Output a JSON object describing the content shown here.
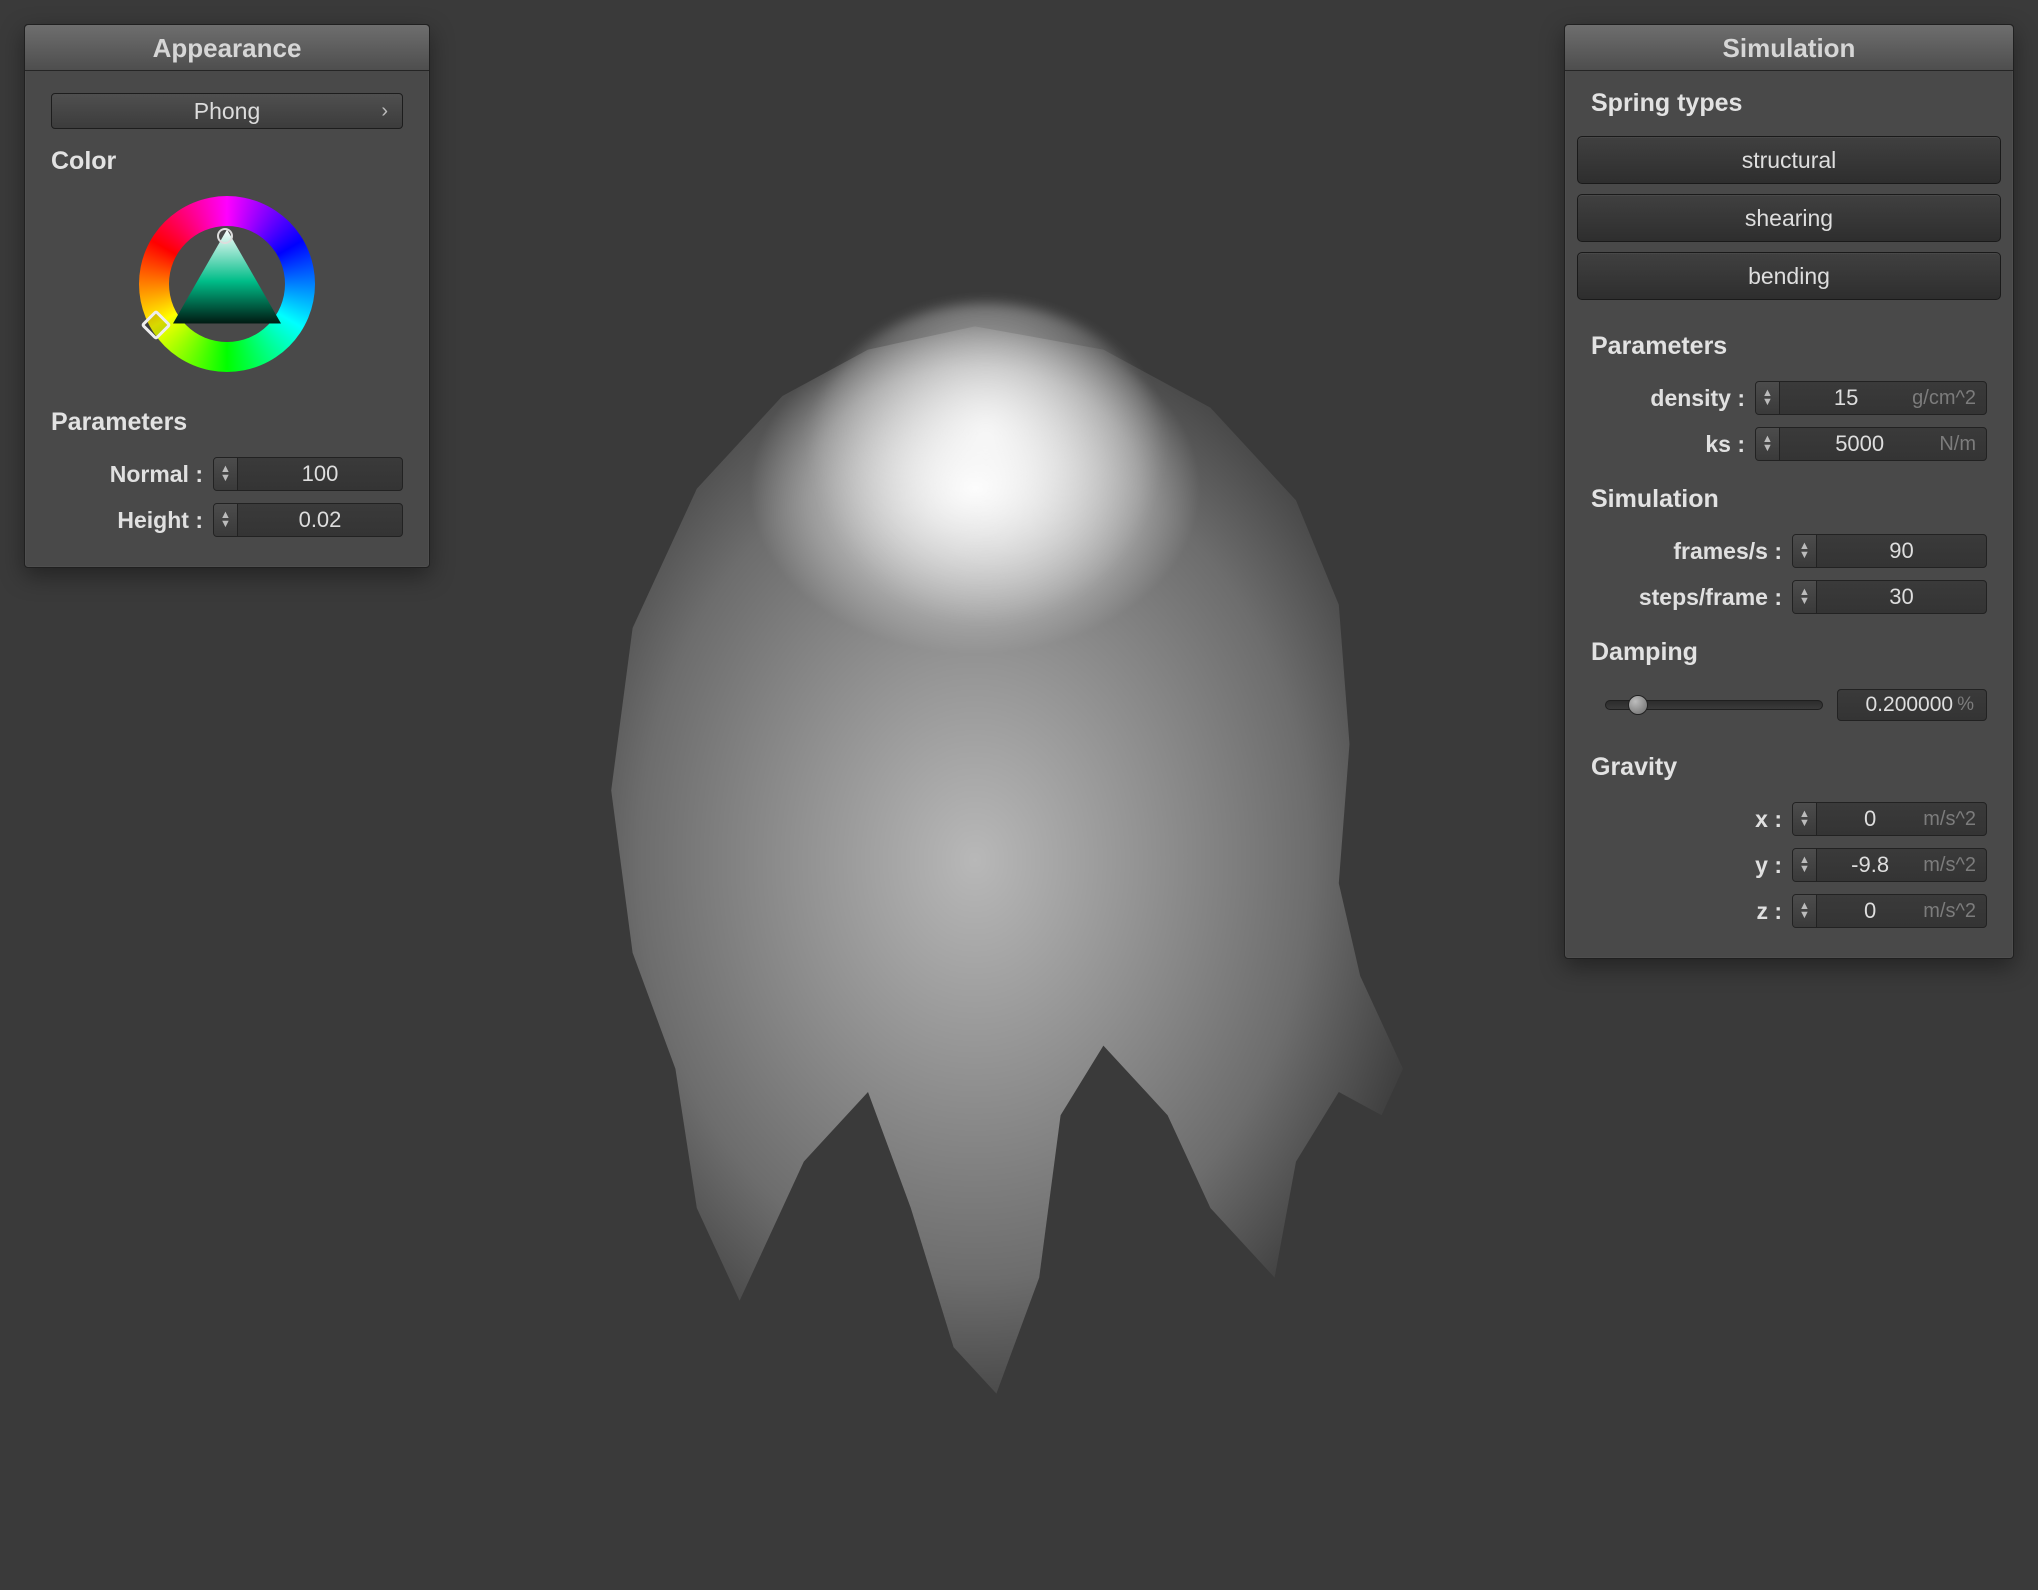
{
  "appearance": {
    "panel_title": "Appearance",
    "shader_dropdown": {
      "value": "Phong"
    },
    "color_label": "Color",
    "parameters_label": "Parameters",
    "normal": {
      "label": "Normal :",
      "value": "100"
    },
    "height": {
      "label": "Height :",
      "value": "0.02"
    }
  },
  "simulation": {
    "panel_title": "Simulation",
    "spring_types_label": "Spring types",
    "spring_types": {
      "structural": "structural",
      "shearing": "shearing",
      "bending": "bending"
    },
    "parameters_label": "Parameters",
    "density": {
      "label": "density :",
      "value": "15",
      "unit": "g/cm^2"
    },
    "ks": {
      "label": "ks :",
      "value": "5000",
      "unit": "N/m"
    },
    "simulation_label": "Simulation",
    "frames": {
      "label": "frames/s :",
      "value": "90"
    },
    "steps": {
      "label": "steps/frame :",
      "value": "30"
    },
    "damping_label": "Damping",
    "damping": {
      "value": "0.200000",
      "unit": "%"
    },
    "gravity_label": "Gravity",
    "gravity": {
      "x": {
        "label": "x :",
        "value": "0",
        "unit": "m/s^2"
      },
      "y": {
        "label": "y :",
        "value": "-9.8",
        "unit": "m/s^2"
      },
      "z": {
        "label": "z :",
        "value": "0",
        "unit": "m/s^2"
      }
    }
  }
}
